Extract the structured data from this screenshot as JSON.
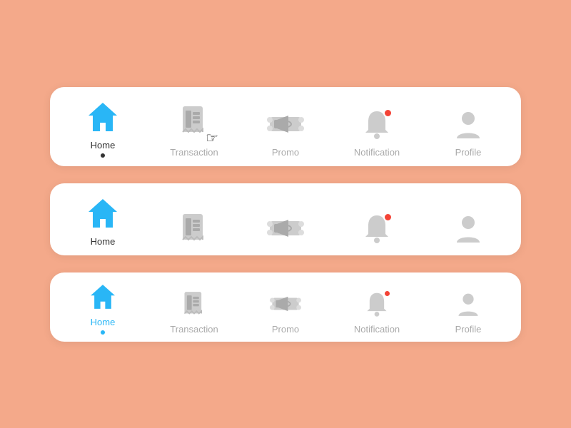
{
  "bars": [
    {
      "id": "bar1",
      "style": "large-active",
      "items": [
        {
          "id": "home",
          "label": "Home",
          "state": "active",
          "showLabel": true,
          "showDot": true,
          "dotStyle": "dark"
        },
        {
          "id": "transaction",
          "label": "Transaction",
          "state": "inactive",
          "showLabel": true,
          "showCursor": true
        },
        {
          "id": "promo",
          "label": "Promo",
          "state": "inactive",
          "showLabel": true
        },
        {
          "id": "notification",
          "label": "Notification",
          "state": "inactive",
          "showLabel": true,
          "hasBadge": true
        },
        {
          "id": "profile",
          "label": "Profile",
          "state": "inactive",
          "showLabel": true
        }
      ]
    },
    {
      "id": "bar2",
      "style": "large-no-label",
      "items": [
        {
          "id": "home",
          "label": "Home",
          "state": "active",
          "showLabel": true,
          "showDot": false
        },
        {
          "id": "transaction",
          "label": "",
          "state": "inactive",
          "showLabel": false
        },
        {
          "id": "promo",
          "label": "",
          "state": "inactive",
          "showLabel": false
        },
        {
          "id": "notification",
          "label": "",
          "state": "inactive",
          "showLabel": false,
          "hasBadge": true
        },
        {
          "id": "profile",
          "label": "",
          "state": "inactive",
          "showLabel": false
        }
      ]
    },
    {
      "id": "bar3",
      "style": "small",
      "items": [
        {
          "id": "home",
          "label": "Home",
          "state": "active-blue",
          "showLabel": true,
          "showDot": true,
          "dotStyle": "blue"
        },
        {
          "id": "transaction",
          "label": "Transaction",
          "state": "inactive",
          "showLabel": true
        },
        {
          "id": "promo",
          "label": "Promo",
          "state": "inactive",
          "showLabel": true
        },
        {
          "id": "notification",
          "label": "Notification",
          "state": "inactive",
          "showLabel": true,
          "hasBadge": true
        },
        {
          "id": "profile",
          "label": "Profile",
          "state": "inactive",
          "showLabel": true
        }
      ]
    }
  ]
}
